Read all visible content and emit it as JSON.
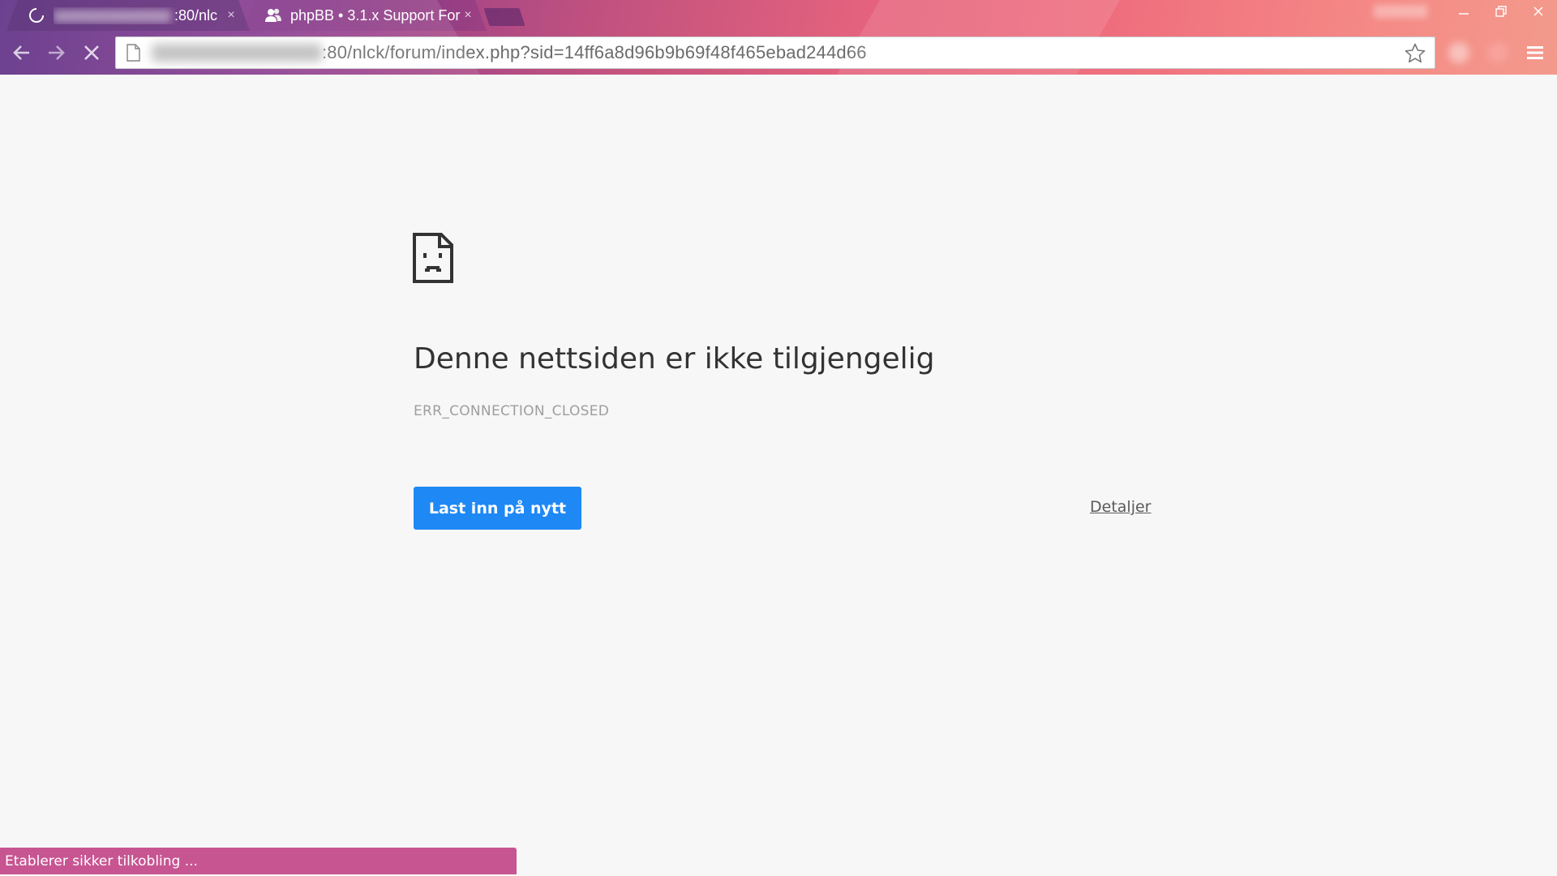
{
  "browser": {
    "tabs": [
      {
        "title_suffix": ":80/nlc",
        "close": "×",
        "state": "loading"
      },
      {
        "title": "phpBB • 3.1.x Support For",
        "close": "×",
        "state": "active"
      }
    ],
    "address": {
      "url_visible": ":80/nlck/forum/index.php?sid=14ff6a8d96b9b69f48f465ebad244d66"
    },
    "icons": {
      "back": "back-arrow-icon",
      "forward": "forward-arrow-icon",
      "stop": "stop-icon",
      "page": "page-icon",
      "bookmark": "star-icon",
      "menu": "hamburger-menu-icon"
    }
  },
  "error_page": {
    "heading": "Denne nettsiden er ikke tilgjengelig",
    "code": "ERR_CONNECTION_CLOSED",
    "reload_button": "Last inn på nytt",
    "details_link": "Detaljer"
  },
  "status_bar": {
    "text": "Etablerer sikker tilkobling ..."
  },
  "colors": {
    "reload_button": "#1e88f5",
    "status_bubble": "#c75592",
    "page_background": "#f7f7f7"
  }
}
